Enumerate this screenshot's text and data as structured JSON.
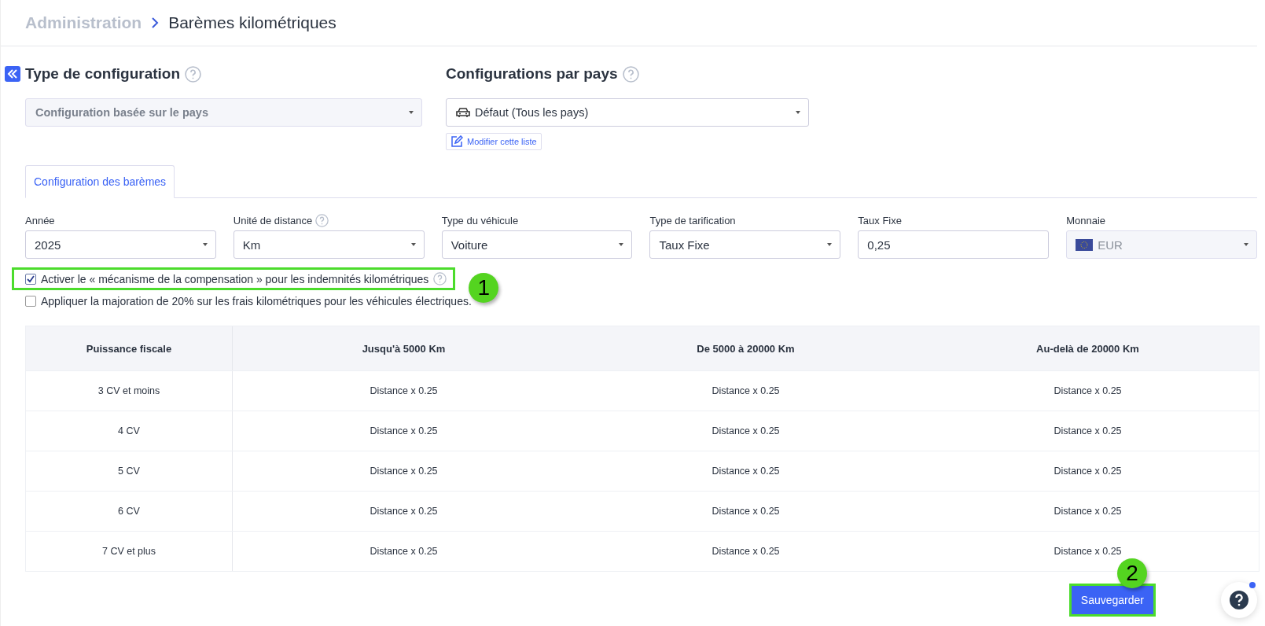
{
  "breadcrumb": [
    {
      "label": "Administration",
      "current": false
    },
    {
      "label": "Barèmes kilométriques",
      "current": true
    }
  ],
  "sections": [
    {
      "title": "Type de configuration",
      "select": {
        "value": "Configuration basée sur le pays",
        "disabled": true
      }
    },
    {
      "title": "Configurations par pays",
      "select": {
        "value": "Défaut (Tous les pays)",
        "disabled": false
      },
      "link": "Modifier cette liste"
    }
  ],
  "tabs": [
    {
      "label": "Configuration des barèmes",
      "selected": true
    }
  ],
  "fields": [
    {
      "label": "Année",
      "kind": "select",
      "value": "2025",
      "disabled": false
    },
    {
      "label": "Unité de distance",
      "kind": "select",
      "value": "Km",
      "help": true,
      "disabled": false
    },
    {
      "label": "Type du véhicule",
      "kind": "select",
      "value": "Voiture",
      "disabled": false
    },
    {
      "label": "Type de tarification",
      "kind": "select",
      "value": "Taux Fixe",
      "disabled": false
    },
    {
      "label": "Taux Fixe",
      "kind": "input",
      "value": "0,25",
      "disabled": false
    },
    {
      "label": "Monnaie",
      "kind": "currency",
      "value": "EUR",
      "disabled": true
    }
  ],
  "options": [
    {
      "label": "Activer le « mécanisme de la compensation » pour les indemnités kilométriques",
      "checked": true,
      "help": true,
      "callout": "1"
    },
    {
      "label": "Appliquer la majoration de 20% sur les frais kilométriques pour les véhicules électriques.",
      "checked": false
    }
  ],
  "table": {
    "columns": [
      "Puissance fiscale",
      "Jusqu'à 5000 Km",
      "De 5000 à 20000 Km",
      "Au-delà de 20000 Km"
    ],
    "rows": [
      [
        "3 CV et moins",
        "Distance x 0.25",
        "Distance x 0.25",
        "Distance x 0.25"
      ],
      [
        "4 CV",
        "Distance x 0.25",
        "Distance x 0.25",
        "Distance x 0.25"
      ],
      [
        "5 CV",
        "Distance x 0.25",
        "Distance x 0.25",
        "Distance x 0.25"
      ],
      [
        "6 CV",
        "Distance x 0.25",
        "Distance x 0.25",
        "Distance x 0.25"
      ],
      [
        "7 CV et plus",
        "Distance x 0.25",
        "Distance x 0.25",
        "Distance x 0.25"
      ]
    ]
  },
  "save_button": {
    "label": "Sauvegarder",
    "callout": "2"
  }
}
